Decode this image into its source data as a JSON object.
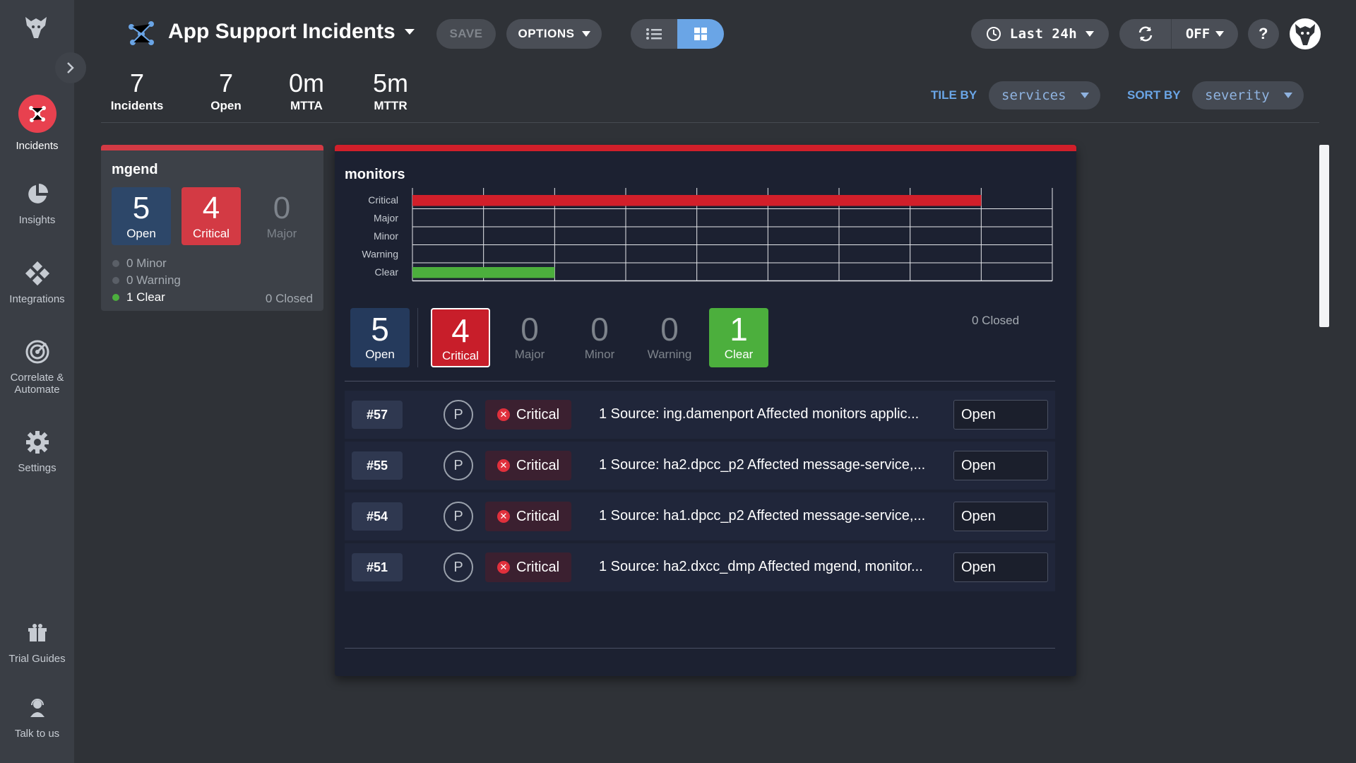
{
  "header": {
    "title": "App Support Incidents",
    "save_label": "SAVE",
    "options_label": "OPTIONS",
    "time_range": "Last 24h",
    "refresh_state": "OFF",
    "help_label": "?"
  },
  "sidebar": {
    "items": [
      {
        "label": "Incidents"
      },
      {
        "label": "Insights"
      },
      {
        "label": "Integrations"
      },
      {
        "label": "Correlate & Automate"
      },
      {
        "label": "Settings"
      },
      {
        "label": "Trial Guides"
      },
      {
        "label": "Talk to us"
      }
    ]
  },
  "stats": [
    {
      "value": "7",
      "label": "Incidents"
    },
    {
      "value": "7",
      "label": "Open"
    },
    {
      "value": "0m",
      "label": "MTTA"
    },
    {
      "value": "5m",
      "label": "MTTR"
    }
  ],
  "controls": {
    "tile_by_label": "TILE BY",
    "tile_by_value": "services",
    "sort_by_label": "SORT BY",
    "sort_by_value": "severity"
  },
  "tile_mgend": {
    "name": "mgend",
    "open": {
      "count": "5",
      "label": "Open"
    },
    "critical": {
      "count": "4",
      "label": "Critical"
    },
    "major": {
      "count": "0",
      "label": "Major"
    },
    "minor_text": "0 Minor",
    "warning_text": "0 Warning",
    "clear_text": "1 Clear",
    "closed_text": "0 Closed"
  },
  "tile_monitors": {
    "name": "monitors",
    "counts": [
      {
        "count": "5",
        "label": "Open"
      },
      {
        "count": "4",
        "label": "Critical"
      },
      {
        "count": "0",
        "label": "Major"
      },
      {
        "count": "0",
        "label": "Minor"
      },
      {
        "count": "0",
        "label": "Warning"
      },
      {
        "count": "1",
        "label": "Clear"
      }
    ],
    "closed_text": "0 Closed",
    "incidents": [
      {
        "id": "#57",
        "priority": "P",
        "severity": "Critical",
        "description": "1 Source: ing.damenport Affected monitors applic...",
        "status": "Open"
      },
      {
        "id": "#55",
        "priority": "P",
        "severity": "Critical",
        "description": "1 Source: ha2.dpcc_p2 Affected message-service,...",
        "status": "Open"
      },
      {
        "id": "#54",
        "priority": "P",
        "severity": "Critical",
        "description": "1 Source: ha1.dpcc_p2 Affected message-service,...",
        "status": "Open"
      },
      {
        "id": "#51",
        "priority": "P",
        "severity": "Critical",
        "description": "1 Source: ha2.dxcc_dmp Affected mgend, monitor...",
        "status": "Open"
      }
    ]
  },
  "chart_data": {
    "type": "bar",
    "orientation": "horizontal-timeline",
    "categories": [
      "Critical",
      "Major",
      "Minor",
      "Warning",
      "Clear"
    ],
    "x_segments": 9,
    "series": [
      {
        "category": "Critical",
        "start": 0,
        "end": 8,
        "color": "#d11f2a"
      },
      {
        "category": "Clear",
        "start": 0,
        "end": 2,
        "color": "#4caf3d"
      }
    ],
    "grid": true
  },
  "colors": {
    "accent": "#6aa5e6",
    "critical": "#d33a44",
    "clear": "#4caf3d",
    "open": "#2d4769"
  }
}
